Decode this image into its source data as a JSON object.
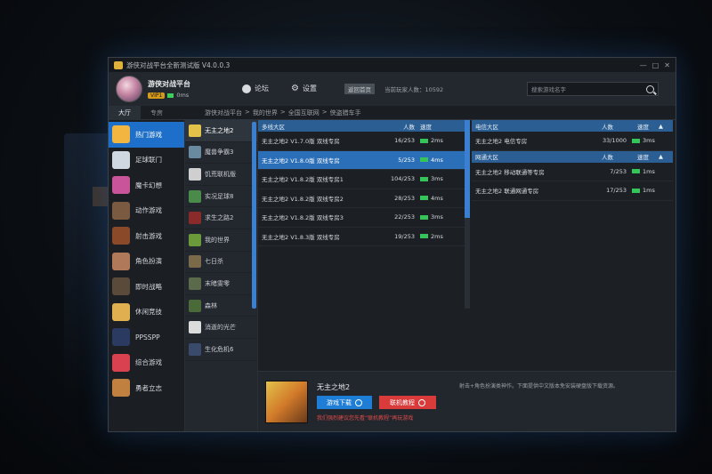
{
  "window": {
    "title": "游侠对战平台全新测试版 V4.0.0.3",
    "controls": [
      "—",
      "□",
      "✕"
    ]
  },
  "header": {
    "platform_name": "游侠对战平台",
    "vip_label": "VIP1",
    "ping": "0ms",
    "forum_label": "论坛",
    "settings_label": "设置",
    "back_home_label": "返回首页",
    "online_count": "当前玩家人数：10592",
    "search_placeholder": "搜索游戏名字"
  },
  "tabs": [
    "大厅",
    "专房"
  ],
  "breadcrumb": [
    "游侠对战平台",
    "我的世界",
    "全国互联网",
    "侠盗猎车手"
  ],
  "categories": [
    {
      "label": "热门游戏",
      "color": "#f2b640",
      "active": true
    },
    {
      "label": "足球联门",
      "color": "#cfd8e0"
    },
    {
      "label": "魔卡幻想",
      "color": "#c9549a"
    },
    {
      "label": "动作游戏",
      "color": "#7a5a40"
    },
    {
      "label": "射击游戏",
      "color": "#8a4a2a"
    },
    {
      "label": "角色扮演",
      "color": "#b07a5a"
    },
    {
      "label": "即时战略",
      "color": "#5a4a3a"
    },
    {
      "label": "休闲竞技",
      "color": "#e0b050"
    },
    {
      "label": "PPSSPP",
      "color": "#2a3a60"
    },
    {
      "label": "综合游戏",
      "color": "#d94050"
    },
    {
      "label": "勇者立志",
      "color": "#c08040"
    }
  ],
  "games": [
    {
      "label": "无主之地2",
      "color": "#e3c24a",
      "active": true
    },
    {
      "label": "魔兽争霸3",
      "color": "#6a8aa0"
    },
    {
      "label": "饥荒联机版",
      "color": "#cfcfcf"
    },
    {
      "label": "实况足球8",
      "color": "#4a8a4a"
    },
    {
      "label": "求生之路2",
      "color": "#8a2a2a"
    },
    {
      "label": "我的世界",
      "color": "#6a9a3a"
    },
    {
      "label": "七日杀",
      "color": "#7a6a4a"
    },
    {
      "label": "末睹雯零",
      "color": "#5a6a4a"
    },
    {
      "label": "森林",
      "color": "#4a6a3a"
    },
    {
      "label": "消逝的光芒",
      "color": "#dcdcdc"
    },
    {
      "label": "生化危机6",
      "color": "#3a4a6a"
    }
  ],
  "server_list": {
    "header": {
      "name": "多线大区",
      "pop": "人数",
      "speed": "速度"
    },
    "rows": [
      {
        "name": "无主之地2 V1.7.0版 双线专房",
        "pop": "16/253",
        "speed": "2ms"
      },
      {
        "name": "无主之地2 V1.8.0版 双线专房",
        "pop": "5/253",
        "speed": "4ms",
        "selected": true
      },
      {
        "name": "无主之地2 V1.8.2版 双线专房1",
        "pop": "104/253",
        "speed": "3ms"
      },
      {
        "name": "无主之地2 V1.8.2版 双线专房2",
        "pop": "28/253",
        "speed": "4ms"
      },
      {
        "name": "无主之地2 V1.8.2版 双线专房3",
        "pop": "22/253",
        "speed": "3ms"
      },
      {
        "name": "无主之地2 V1.8.3版 双线专房",
        "pop": "19/253",
        "speed": "2ms"
      }
    ]
  },
  "right_lists": [
    {
      "header": {
        "name": "电信大区",
        "pop": "人数",
        "speed": "速度",
        "arrow": "▲"
      },
      "rows": [
        {
          "name": "无主之地2 电信专房",
          "pop": "33/1000",
          "speed": "3ms"
        }
      ]
    },
    {
      "header": {
        "name": "网通大区",
        "pop": "人数",
        "speed": "速度",
        "arrow": "▲"
      },
      "rows": [
        {
          "name": "无主之地2 移动联通等专房",
          "pop": "7/253",
          "speed": "1ms"
        },
        {
          "name": "无主之地2 联通网通专房",
          "pop": "17/253",
          "speed": "1ms"
        }
      ]
    }
  ],
  "detail": {
    "title": "无主之地2",
    "download_label": "游戏下载",
    "tutorial_label": "联机教程",
    "note": "我们强烈建议您先看“联机教程”再玩游戏",
    "description": "射击+角色扮演类神作。下面提供中文版本免安装硬盘版下载资源。"
  },
  "colors": {
    "accent": "#1e6fc9",
    "speed_ok": "#34c458",
    "danger": "#d93a3a"
  }
}
